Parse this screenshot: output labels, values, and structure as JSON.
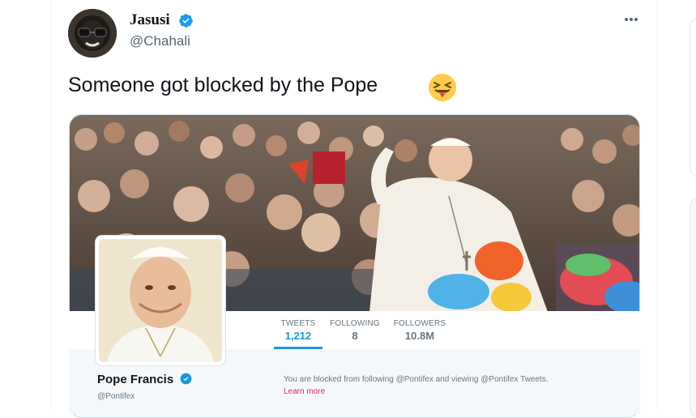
{
  "colors": {
    "accent": "#1d9bf0",
    "text_primary": "#0f1419",
    "text_secondary": "#536471",
    "legacy_accent": "#1b95e0",
    "learn_more": "#e0245e"
  },
  "tweet": {
    "author_name": "Jasusi",
    "handle": "@Chahali",
    "text": "Someone got blocked by the Pope",
    "emoji": "squinting-face-with-tongue",
    "more_icon": "more-horizontal-icon",
    "verified_icon": "verified-badge-icon"
  },
  "embedded_profile": {
    "stats": [
      {
        "label": "TWEETS",
        "value": "1,212"
      },
      {
        "label": "FOLLOWING",
        "value": "8"
      },
      {
        "label": "FOLLOWERS",
        "value": "10.8M"
      }
    ],
    "name": "Pope Francis",
    "handle": "@Pontifex",
    "blocked_message": "You are blocked from following @Pontifex and viewing @Pontifex Tweets.",
    "learn_more": "Learn more"
  }
}
